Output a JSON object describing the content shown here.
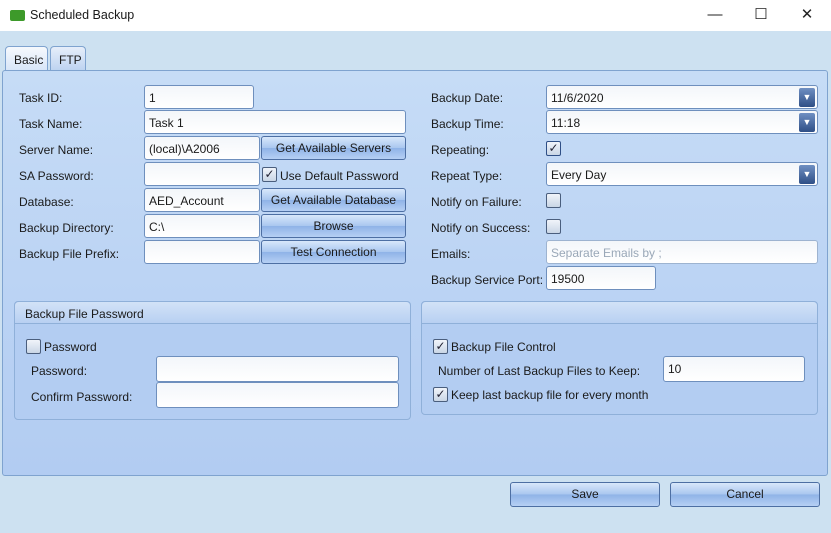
{
  "window": {
    "title": "Scheduled Backup",
    "minimize": "—",
    "maximize": "☐",
    "close": "✕"
  },
  "tabs": [
    {
      "label": "Basic"
    },
    {
      "label": "FTP"
    }
  ],
  "left": {
    "task_id": {
      "label": "Task ID:",
      "value": "1"
    },
    "task_name": {
      "label": "Task Name:",
      "value": "Task 1"
    },
    "server_name": {
      "label": "Server Name:",
      "value": "(local)\\A2006",
      "button": "Get Available Servers"
    },
    "sa_password": {
      "label": "SA Password:",
      "value": "",
      "checkbox": "Use Default Password",
      "checked": true
    },
    "database": {
      "label": "Database:",
      "value": "AED_Account",
      "button": "Get Available Database"
    },
    "backup_directory": {
      "label": "Backup Directory:",
      "value": "C:\\",
      "button": "Browse"
    },
    "backup_prefix": {
      "label": "Backup File Prefix:",
      "value": "",
      "button": "Test Connection"
    }
  },
  "right": {
    "backup_date": {
      "label": "Backup Date:",
      "value": "11/6/2020"
    },
    "backup_time": {
      "label": "Backup Time:",
      "value": "11:18"
    },
    "repeating": {
      "label": "Repeating:",
      "checked": true
    },
    "repeat_type": {
      "label": "Repeat Type:",
      "value": "Every Day"
    },
    "notify_failure": {
      "label": "Notify on Failure:",
      "checked": false
    },
    "notify_success": {
      "label": "Notify on Success:",
      "checked": false
    },
    "emails": {
      "label": "Emails:",
      "placeholder": "Separate Emails by ;",
      "value": ""
    },
    "port": {
      "label": "Backup Service Port:",
      "value": "19500"
    }
  },
  "password_group": {
    "title": "Backup File Password",
    "checkbox": "Password",
    "checked": false,
    "password_label": "Password:",
    "confirm_label": "Confirm Password:"
  },
  "control_group": {
    "title": "",
    "checkbox": "Backup File Control",
    "checked": true,
    "keep_label": "Number of Last Backup Files to Keep:",
    "keep_value": "10",
    "monthly": "Keep last backup file for every month",
    "monthly_checked": true
  },
  "footer": {
    "save": "Save",
    "cancel": "Cancel"
  },
  "glyphs": {
    "check": "✓",
    "dropdown": "▼"
  }
}
